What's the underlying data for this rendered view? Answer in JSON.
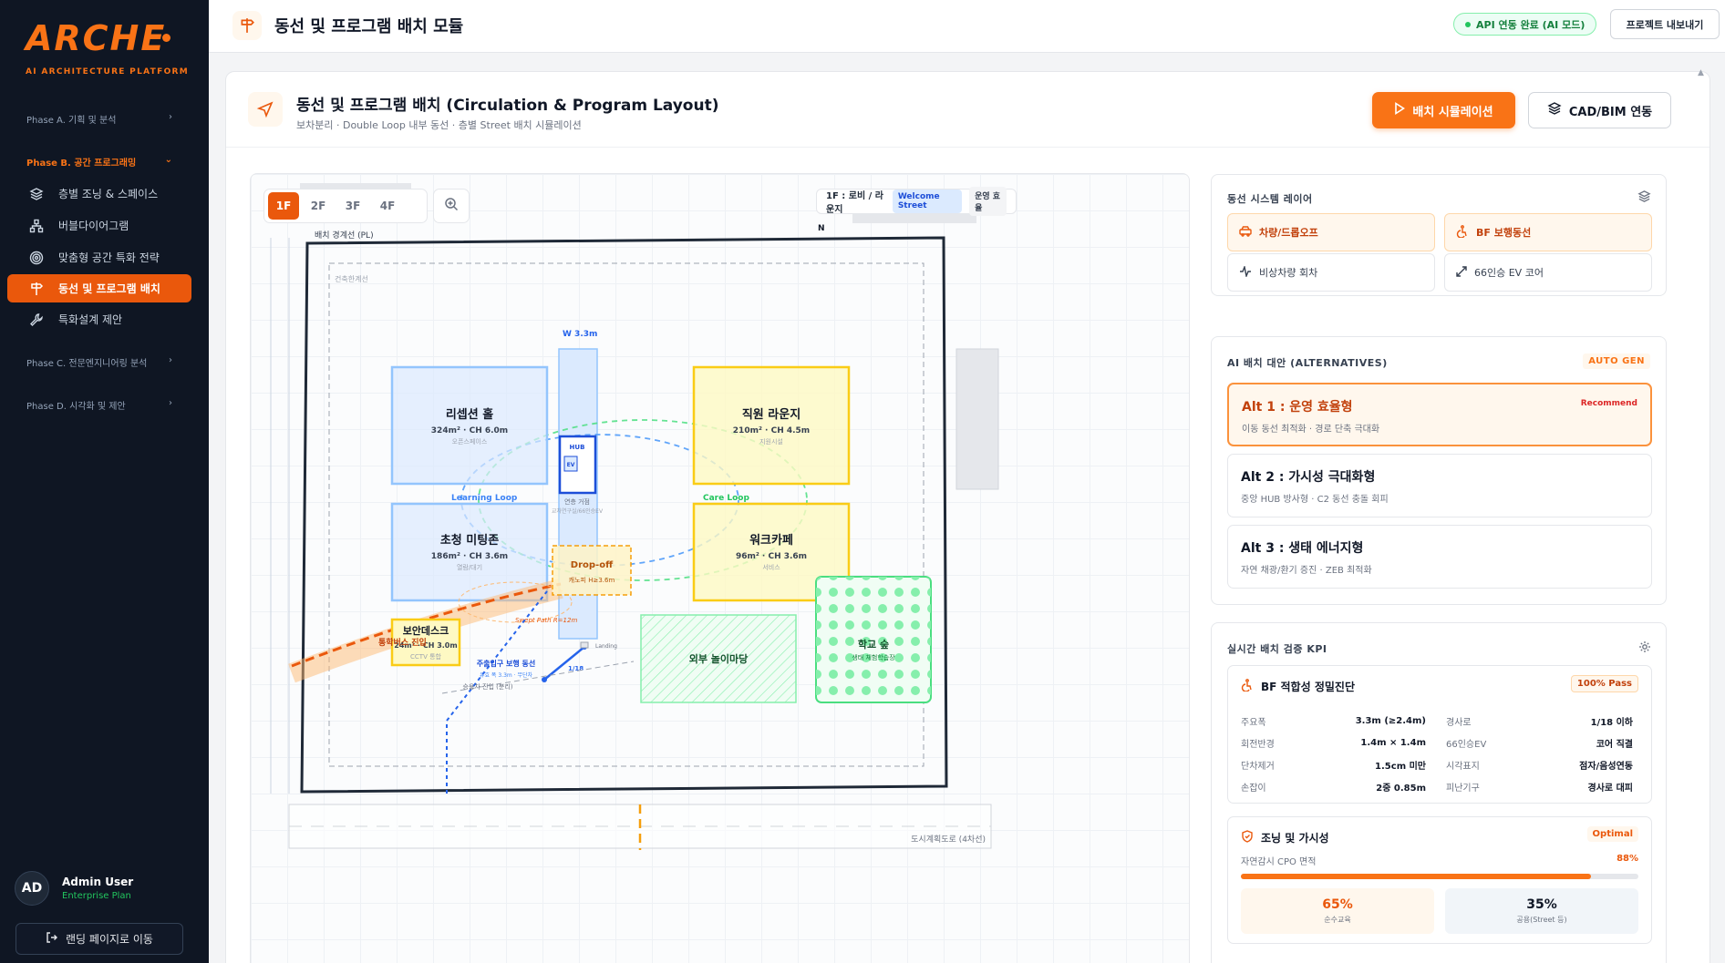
{
  "sidebar": {
    "logo": "ARCHE",
    "tagline": "AI ARCHITECTURE PLATFORM",
    "phases": [
      {
        "label": "Phase A. 기획 및 분석"
      },
      {
        "label": "Phase B. 공간 프로그래밍"
      },
      {
        "label": "Phase C. 전문엔지니어링 분석"
      },
      {
        "label": "Phase D. 시각화 및 제안"
      }
    ],
    "items": [
      {
        "label": "층별 조닝 & 스페이스",
        "icon": "layers-icon"
      },
      {
        "label": "버블다이어그램",
        "icon": "network-icon"
      },
      {
        "label": "맞춤형 공간 특화 전략",
        "icon": "target-icon"
      },
      {
        "label": "동선 및 프로그램 배치",
        "icon": "signpost-icon"
      },
      {
        "label": "특화설계 제안",
        "icon": "wrench-icon"
      }
    ],
    "user": {
      "initials": "AD",
      "name": "Admin User",
      "plan": "Enterprise Plan"
    },
    "landing_button": "랜딩 페이지로 이동"
  },
  "topbar": {
    "title": "동선 및 프로그램 배치 모듈",
    "api_status": "API 연동 완료 (AI 모드)",
    "export_button": "프로젝트 내보내기"
  },
  "main": {
    "title": "동선 및 프로그램 배치 (Circulation & Program Layout)",
    "subtitle": "보차분리 · Double Loop 내부 동선 · 층별 Street 배치 시뮬레이션",
    "simulate_button": "배치 시뮬레이션",
    "cad_button": "CAD/BIM 연동"
  },
  "plan": {
    "floors": [
      "1F",
      "2F",
      "3F",
      "4F"
    ],
    "active_floor": "1F",
    "floor_info": "1F : 로비 / 라운지",
    "floor_tag": "Welcome Street",
    "floor_tag2": "운영 효율",
    "north": "N",
    "site_label": "배치 경계선 (PL)",
    "setback_label": "건축한계선",
    "corridor_label": "W 3.3m",
    "rooms": [
      {
        "name": "리셉션 홀",
        "spec": "324m² · CH 6.0m",
        "use": "오픈스페이스"
      },
      {
        "name": "직원 라운지",
        "spec": "210m² · CH 4.5m",
        "use": "지원시설"
      },
      {
        "name": "초청 미팅존",
        "spec": "186m² · CH 3.6m",
        "use": "열람/대기"
      },
      {
        "name": "워크카페",
        "spec": "96m² · CH 3.6m",
        "use": "서비스"
      },
      {
        "name": "보안데스크",
        "spec": "24m² · CH 3.0m",
        "use": "CCTV 통합"
      }
    ],
    "hub": "HUB",
    "ev": "EV",
    "hub_caption1": "연층 거점",
    "hub_caption2": "교차연구실/66인승EV",
    "learning_loop": "Learning Loop",
    "care_loop": "Care Loop",
    "dropoff": "Drop-off",
    "dropoff_sub": "캐노피 H≥3.6m",
    "bus": "통학버스 진입",
    "swept": "Swept Path R=12m",
    "landing": "Landing",
    "main_walk": "주출입구 보행 동선",
    "main_walk_sub": "유효 폭 3.3m · 무단차",
    "ramp": "1/18",
    "car": "승용차 진입 (분리)",
    "outdoor": "외부 놀이마당",
    "forest": "학교 숲",
    "forest_sub": "생태 체험학습장",
    "road": "도시계획도로 (4차선)"
  },
  "layers": {
    "title": "동선 시스템 레이어",
    "items": [
      {
        "label": "차량/드롭오프",
        "icon": "car-icon",
        "active": true
      },
      {
        "label": "BF 보행동선",
        "icon": "accessibility-icon",
        "active": true
      },
      {
        "label": "비상차량 회차",
        "icon": "activity-icon",
        "active": false
      },
      {
        "label": "66인승 EV 코어",
        "icon": "expand-icon",
        "active": false
      }
    ]
  },
  "alternatives": {
    "title": "AI 배치 대안 (ALTERNATIVES)",
    "badge": "AUTO GEN",
    "items": [
      {
        "title": "Alt 1 : 운영 효율형",
        "desc": "이동 동선 최적화 · 경로 단축 극대화",
        "tag": "Recommend"
      },
      {
        "title": "Alt 2 : 가시성 극대화형",
        "desc": "중앙 HUB 방사형 · C2 동선 충돌 회피",
        "tag": ""
      },
      {
        "title": "Alt 3 : 생태 에너지형",
        "desc": "자연 채광/환기 증진 · ZEB 최적화",
        "tag": ""
      }
    ]
  },
  "kpi": {
    "title": "실시간 배치 검증 KPI",
    "bf": {
      "title": "BF 적합성 정밀진단",
      "badge": "100% Pass",
      "rows": [
        {
          "k": "주요폭",
          "v": "3.3m (≥2.4m)",
          "k2": "경사로",
          "v2": "1/18 이하"
        },
        {
          "k": "회전반경",
          "v": "1.4m × 1.4m",
          "k2": "66인승EV",
          "v2": "코어 직결"
        },
        {
          "k": "단차제거",
          "v": "1.5cm 미만",
          "k2": "시각표지",
          "v2": "점자/음성연동"
        },
        {
          "k": "손잡이",
          "v": "2중 0.85m",
          "k2": "피난기구",
          "v2": "경사로 대피"
        }
      ]
    },
    "light": {
      "title": "조닝 및 가시성",
      "badge": "Optimal",
      "metric_label": "자연감시 CPO 면적",
      "metric_value": "88%",
      "progress": 0.88,
      "stat1_value": "65%",
      "stat1_label": "순수교육",
      "stat2_value": "35%",
      "stat2_label": "공용(Street 등)"
    }
  },
  "colors": {
    "accent": "#f97316",
    "sidebar_bg": "#0f1623",
    "room_blue": "#93c5fd",
    "room_yellow": "#facc15",
    "green": "#4ade80"
  }
}
